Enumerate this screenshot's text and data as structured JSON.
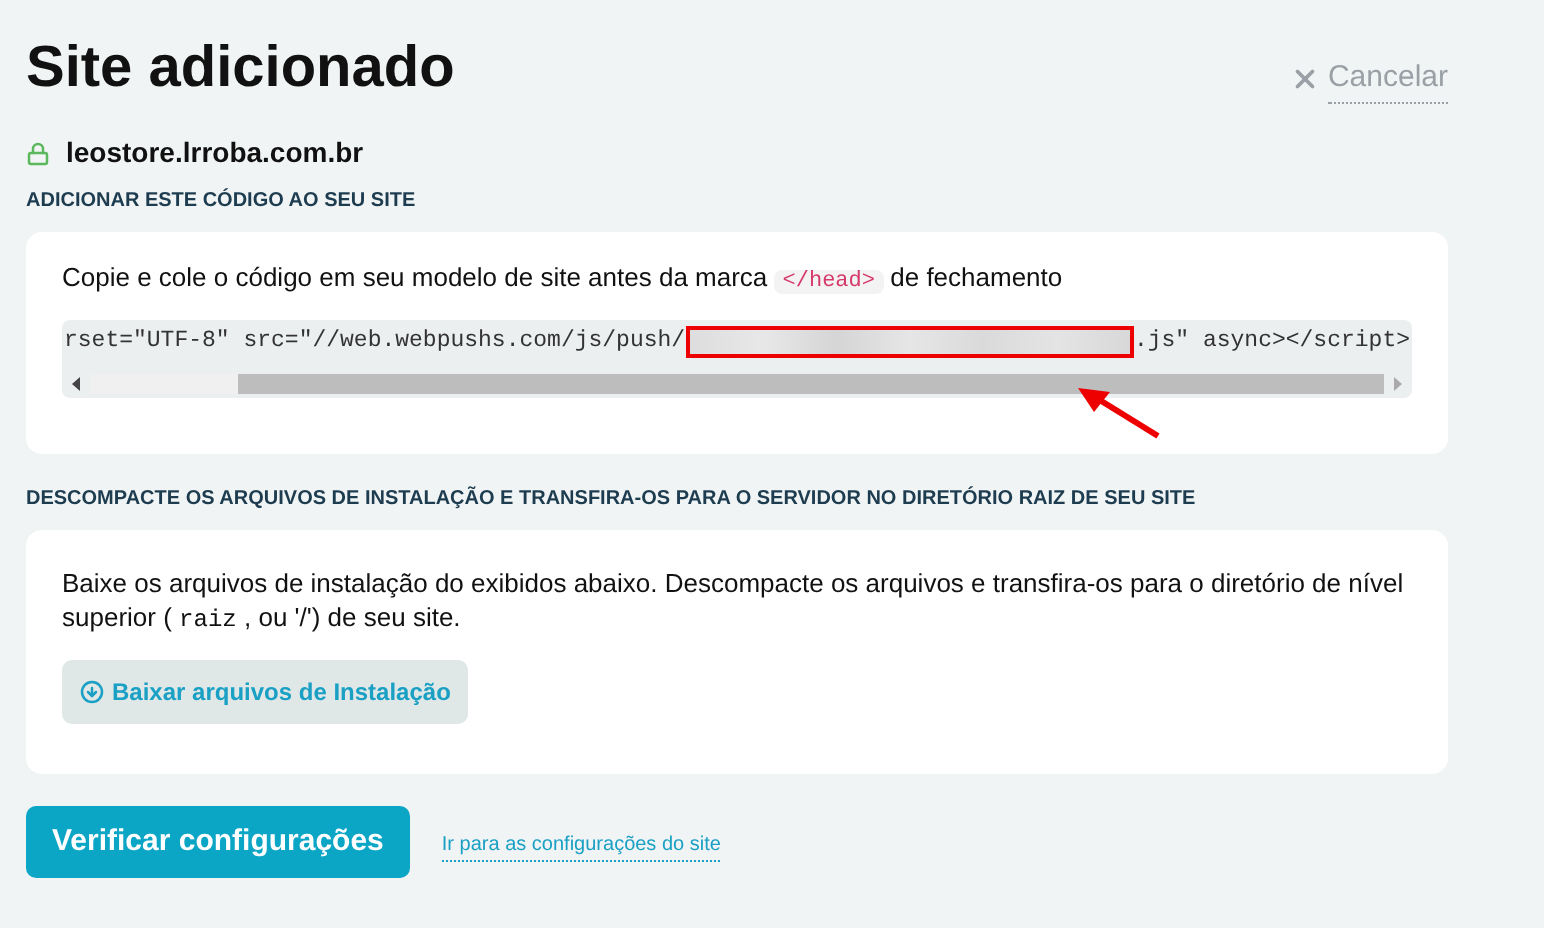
{
  "title": "Site adicionado",
  "cancel": {
    "label": "Cancelar"
  },
  "site": {
    "domain": "leostore.lrroba.com.br",
    "secure": true
  },
  "code_section": {
    "heading": "ADICIONAR ESTE CÓDIGO AO SEU SITE",
    "instruction": {
      "before": "Copie e cole o código em seu modelo de site antes da marca",
      "code": "</head>",
      "after": "de fechamento"
    },
    "snippet": {
      "before": "rset=\"UTF-8\" src=\"//web.webpushs.com/js/push/",
      "after": ".js\" async></script>"
    }
  },
  "files_section": {
    "heading": "DESCOMPACTE OS ARQUIVOS DE INSTALAÇÃO E TRANSFIRA-OS PARA O SERVIDOR NO DIRETÓRIO RAIZ DE SEU SITE",
    "text": {
      "before": "Baixe os arquivos de instalação do exibidos abaixo. Descompacte os arquivos e transfira-os para o diretório de nível superior (",
      "code": "raiz",
      "after": ", ou '/') de seu site."
    },
    "download_button": "Baixar arquivos de Instalação"
  },
  "verify_button": "Verificar configurações",
  "settings_link": "Ir para as configurações do site"
}
